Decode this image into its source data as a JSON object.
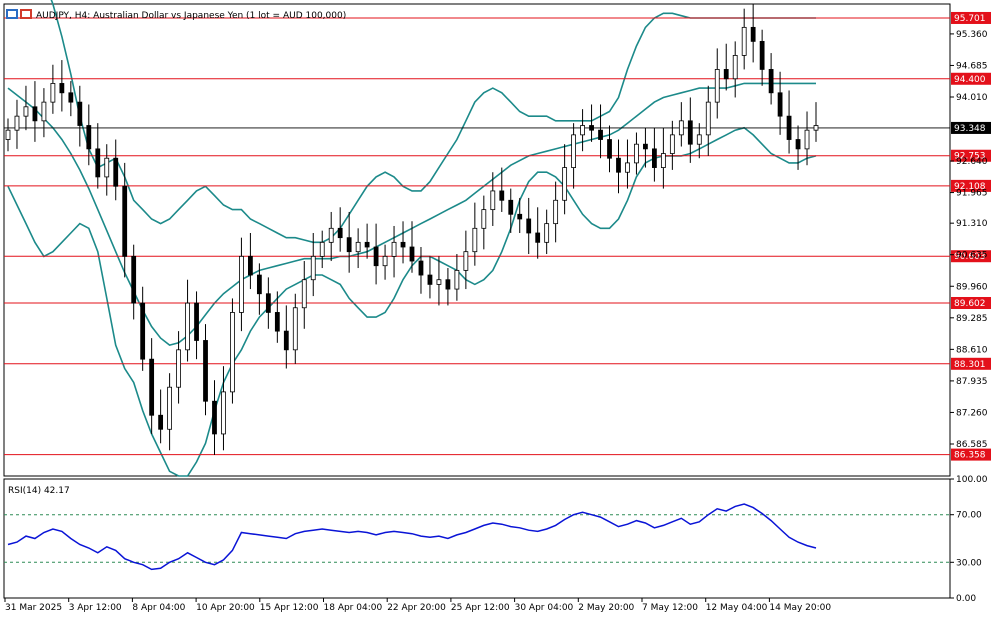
{
  "chart_data": {
    "type": "candlestick",
    "title": "AUDJPY, H4:  Australian Dollar vs Japanese Yen (1 lot = AUD 100,000)",
    "price_axis": {
      "min": 85.9,
      "max": 96.0,
      "ticks": [
        "95.360",
        "94.685",
        "94.010",
        "93.348",
        "92.640",
        "91.965",
        "91.310",
        "90.635",
        "89.960",
        "89.285",
        "88.610",
        "87.935",
        "87.260",
        "86.585"
      ]
    },
    "current_price": "93.348",
    "levels": [
      "95.701",
      "94.400",
      "92.753",
      "92.108",
      "90.603",
      "89.602",
      "88.301",
      "86.358"
    ],
    "x_labels": [
      "31 Mar 2025",
      "3 Apr 12:00",
      "8 Apr 04:00",
      "10 Apr 20:00",
      "15 Apr 12:00",
      "18 Apr 04:00",
      "22 Apr 20:00",
      "25 Apr 12:00",
      "30 Apr 04:00",
      "2 May 20:00",
      "7 May 12:00",
      "12 May 04:00",
      "14 May 20:00"
    ],
    "closes": [
      93.3,
      93.6,
      93.8,
      93.5,
      93.9,
      94.3,
      94.1,
      93.9,
      93.4,
      92.9,
      92.3,
      92.7,
      92.1,
      90.6,
      89.6,
      88.4,
      87.2,
      86.9,
      87.8,
      88.6,
      89.6,
      88.8,
      87.5,
      86.8,
      87.7,
      89.4,
      90.6,
      90.2,
      89.8,
      89.4,
      89.0,
      88.6,
      89.5,
      90.1,
      90.6,
      90.9,
      91.2,
      91.0,
      90.7,
      90.9,
      90.8,
      90.4,
      90.6,
      90.9,
      90.8,
      90.5,
      90.2,
      90.0,
      90.1,
      89.9,
      90.3,
      90.7,
      91.2,
      91.6,
      92.0,
      91.8,
      91.5,
      91.4,
      91.1,
      90.9,
      91.3,
      91.8,
      92.5,
      93.2,
      93.4,
      93.3,
      93.1,
      92.7,
      92.4,
      92.6,
      93.0,
      92.9,
      92.5,
      92.8,
      93.2,
      93.5,
      93.0,
      93.2,
      93.9,
      94.6,
      94.4,
      94.9,
      95.5,
      95.2,
      94.6,
      94.1,
      93.6,
      93.1,
      92.9,
      93.3,
      93.4
    ],
    "rsi": {
      "label": "RSI(14) 42.17",
      "ticks": [
        "100.00",
        "70.00",
        "30.00",
        "0.00"
      ],
      "levels": [
        70,
        30
      ],
      "values": [
        45,
        47,
        52,
        50,
        55,
        58,
        56,
        50,
        45,
        42,
        38,
        43,
        40,
        33,
        30,
        28,
        24,
        25,
        30,
        33,
        38,
        34,
        30,
        28,
        32,
        40,
        55,
        54,
        53,
        52,
        51,
        50,
        54,
        56,
        57,
        58,
        57,
        56,
        55,
        56,
        55,
        53,
        55,
        56,
        55,
        54,
        52,
        51,
        52,
        50,
        53,
        55,
        58,
        61,
        63,
        62,
        60,
        59,
        57,
        56,
        58,
        61,
        66,
        70,
        72,
        70,
        68,
        64,
        60,
        62,
        65,
        63,
        59,
        61,
        64,
        67,
        62,
        64,
        70,
        75,
        73,
        77,
        79,
        76,
        71,
        65,
        58,
        51,
        47,
        44,
        42
      ]
    },
    "bollinger": {
      "mid": [
        94.2,
        94.05,
        93.9,
        93.75,
        93.55,
        93.35,
        93.1,
        92.8,
        92.45,
        92.05,
        91.6,
        91.15,
        90.7,
        90.25,
        89.85,
        89.45,
        89.1,
        88.85,
        88.7,
        88.75,
        88.9,
        89.1,
        89.35,
        89.6,
        89.8,
        89.95,
        90.1,
        90.2,
        90.3,
        90.35,
        90.4,
        90.45,
        90.5,
        90.55,
        90.55,
        90.55,
        90.55,
        90.6,
        90.6,
        90.65,
        90.7,
        90.8,
        90.9,
        91.0,
        91.1,
        91.2,
        91.3,
        91.4,
        91.5,
        91.6,
        91.7,
        91.8,
        91.95,
        92.1,
        92.25,
        92.4,
        92.55,
        92.65,
        92.75,
        92.8,
        92.85,
        92.9,
        92.95,
        93.0,
        93.05,
        93.1,
        93.15,
        93.2,
        93.3,
        93.45,
        93.6,
        93.75,
        93.9,
        94.0,
        94.05,
        94.1,
        94.15,
        94.2,
        94.2,
        94.2,
        94.2,
        94.25,
        94.3,
        94.3,
        94.3,
        94.3,
        94.3,
        94.3,
        94.3,
        94.3,
        94.3
      ],
      "upper": [
        96.3,
        96.4,
        96.5,
        96.6,
        96.5,
        96.0,
        95.3,
        94.5,
        93.6,
        92.9,
        92.5,
        92.6,
        92.7,
        92.3,
        91.8,
        91.6,
        91.4,
        91.3,
        91.4,
        91.6,
        91.8,
        92.0,
        92.1,
        91.9,
        91.7,
        91.6,
        91.6,
        91.4,
        91.3,
        91.2,
        91.1,
        91.0,
        91.0,
        90.95,
        90.9,
        90.9,
        91.0,
        91.2,
        91.5,
        91.8,
        92.1,
        92.3,
        92.4,
        92.3,
        92.1,
        92.0,
        92.0,
        92.2,
        92.5,
        92.8,
        93.1,
        93.5,
        93.9,
        94.1,
        94.2,
        94.1,
        93.9,
        93.7,
        93.6,
        93.6,
        93.6,
        93.5,
        93.5,
        93.5,
        93.5,
        93.5,
        93.6,
        93.7,
        94.0,
        94.6,
        95.1,
        95.5,
        95.7,
        95.8,
        95.8,
        95.75,
        95.7,
        95.7,
        95.7,
        95.7,
        95.7,
        95.7,
        95.7,
        95.7,
        95.7,
        95.7,
        95.7,
        95.7,
        95.7,
        95.7,
        95.7
      ],
      "lower": [
        92.1,
        91.7,
        91.3,
        90.9,
        90.6,
        90.7,
        90.9,
        91.1,
        91.3,
        91.2,
        90.7,
        89.7,
        88.7,
        88.2,
        87.9,
        87.3,
        86.8,
        86.4,
        86.0,
        85.9,
        85.9,
        86.2,
        86.6,
        87.3,
        87.9,
        88.3,
        88.6,
        89.0,
        89.3,
        89.5,
        89.7,
        89.9,
        90.0,
        90.1,
        90.2,
        90.2,
        90.1,
        90.0,
        89.7,
        89.5,
        89.3,
        89.3,
        89.4,
        89.7,
        90.1,
        90.4,
        90.6,
        90.6,
        90.5,
        90.4,
        90.3,
        90.1,
        90.0,
        90.1,
        90.3,
        90.7,
        91.2,
        91.8,
        92.2,
        92.4,
        92.4,
        92.3,
        92.1,
        91.8,
        91.5,
        91.3,
        91.2,
        91.2,
        91.4,
        91.8,
        92.3,
        92.6,
        92.7,
        92.75,
        92.75,
        92.75,
        92.8,
        92.9,
        93.0,
        93.1,
        93.2,
        93.3,
        93.35,
        93.2,
        93.0,
        92.8,
        92.7,
        92.6,
        92.6,
        92.7,
        92.75
      ]
    },
    "colors": {
      "level_line": "#e3101a",
      "band": "#1c8a8a",
      "candle": "#000000",
      "rsi_line": "#0a14d6",
      "rsi_level": "#2e8b57",
      "level_label_bg": "#e3101a",
      "price_label_bg": "#000000"
    }
  }
}
